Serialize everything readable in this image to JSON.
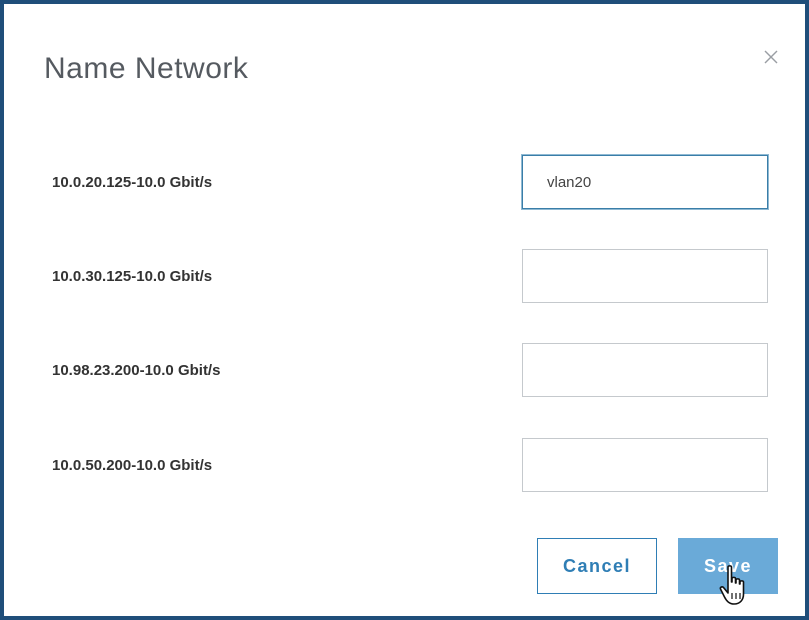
{
  "dialog": {
    "title": "Name Network",
    "close_icon": "close-icon"
  },
  "networks": [
    {
      "label": "10.0.20.125-10.0 Gbit/s",
      "value": "vlan20",
      "placeholder": ""
    },
    {
      "label": "10.0.30.125-10.0 Gbit/s",
      "value": "",
      "placeholder": ""
    },
    {
      "label": "10.98.23.200-10.0 Gbit/s",
      "value": "",
      "placeholder": ""
    },
    {
      "label": "10.0.50.200-10.0 Gbit/s",
      "value": "",
      "placeholder": ""
    }
  ],
  "buttons": {
    "cancel_label": "Cancel",
    "save_label": "Save"
  },
  "colors": {
    "frame_border": "#1f4e7a",
    "primary": "#2f7eb5",
    "save_bg": "#6aaad8",
    "focus_border": "#3a7ea8"
  }
}
